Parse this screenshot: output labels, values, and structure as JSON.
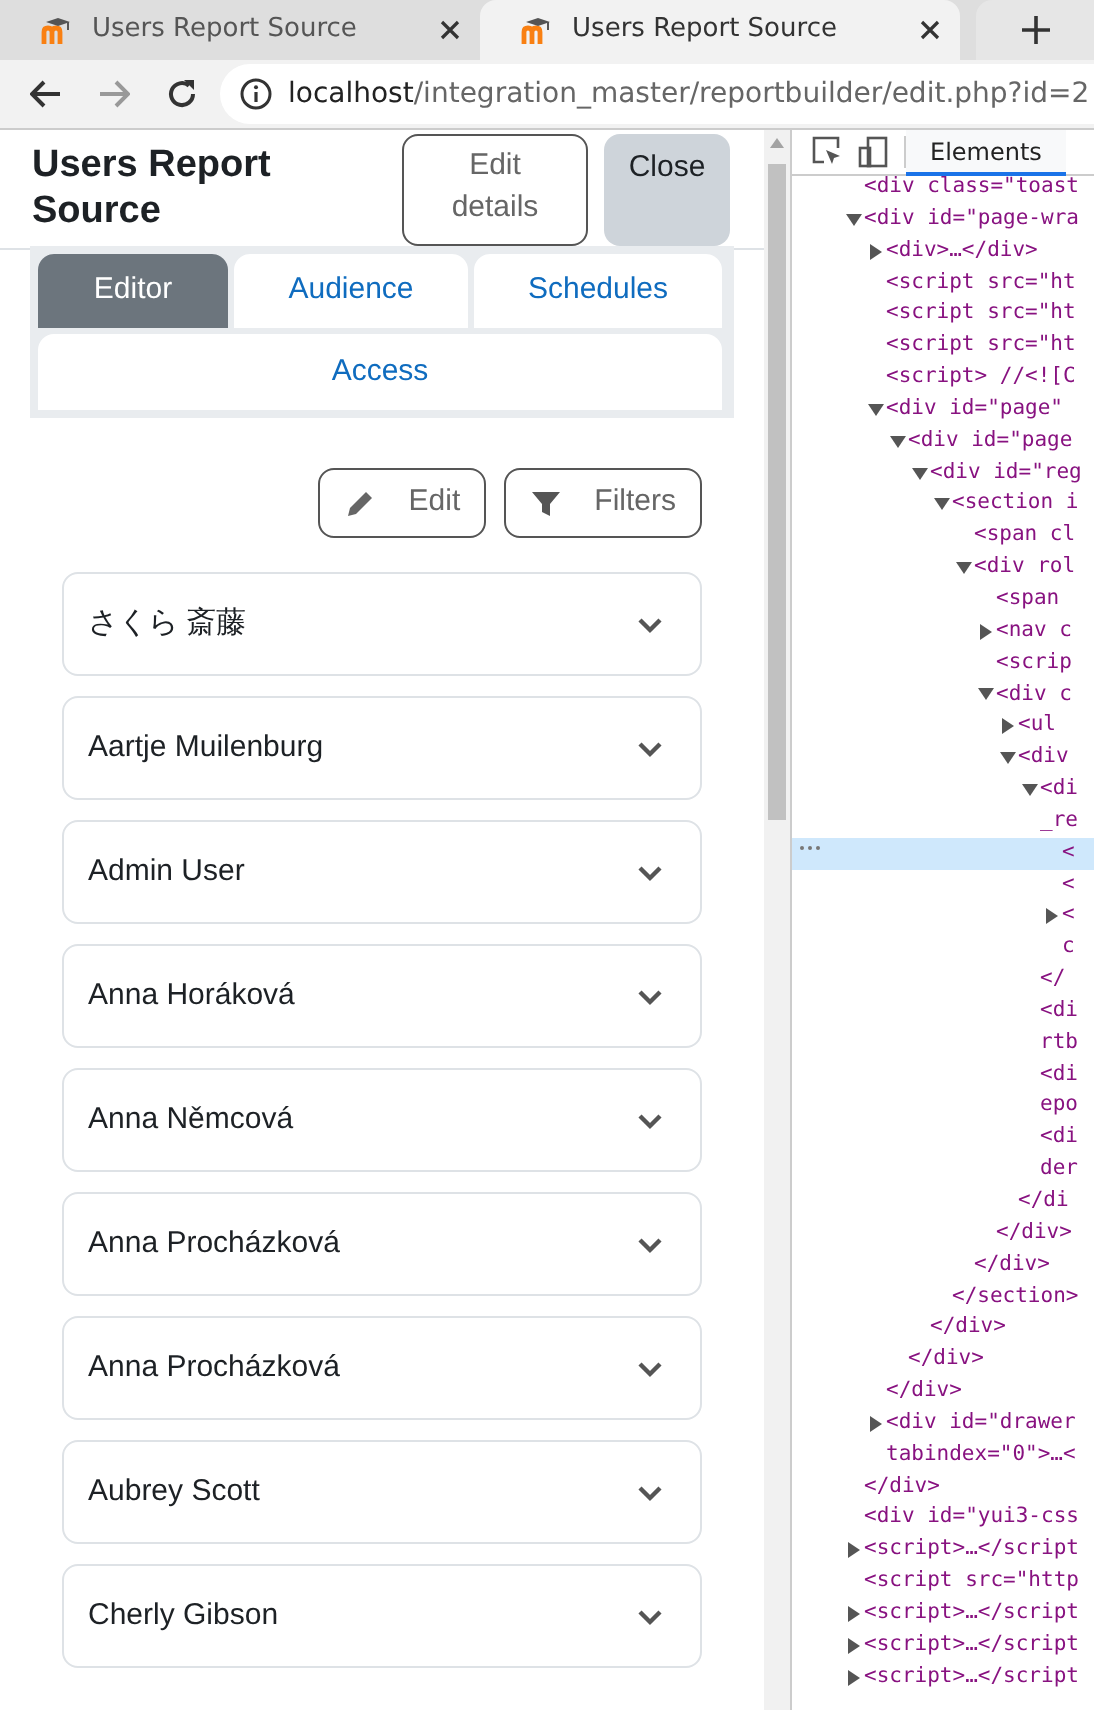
{
  "browser": {
    "tabs": [
      {
        "title": "Users Report Source",
        "selected": false
      },
      {
        "title": "Users Report Source",
        "selected": true
      }
    ],
    "forward_disabled": true,
    "address": {
      "host": "localhost",
      "path": "/integration_master/reportbuilder/edit.php?id=2"
    }
  },
  "page": {
    "title": "Users Report Source",
    "header_buttons": [
      {
        "label": "Edit details",
        "kind": "outline"
      },
      {
        "label": "Close",
        "kind": "secondary"
      }
    ],
    "tabs": [
      {
        "label": "Editor",
        "selected": true
      },
      {
        "label": "Audience",
        "selected": false
      },
      {
        "label": "Schedules",
        "selected": false
      },
      {
        "label": "Access",
        "selected": false
      }
    ],
    "toolbar_buttons": [
      {
        "label": "Edit",
        "kind": "edit"
      },
      {
        "label": "Filters",
        "kind": "filter"
      }
    ],
    "rows": [
      {
        "name": "さくら 斎藤",
        "expanded": false
      },
      {
        "name": "Aartje Muilenburg",
        "expanded": false
      },
      {
        "name": "Admin User",
        "expanded": false
      },
      {
        "name": "Anna Horáková",
        "expanded": false
      },
      {
        "name": "Anna Němcová",
        "expanded": false
      },
      {
        "name": "Anna Procházková",
        "expanded": false
      },
      {
        "name": "Anna Procházková",
        "expanded": false
      },
      {
        "name": "Aubrey Scott",
        "expanded": false
      },
      {
        "name": "Cherly Gibson",
        "expanded": false
      }
    ]
  },
  "devtools": {
    "tabs": [
      {
        "label": "Elements",
        "selected": true
      }
    ],
    "tree": [
      {
        "text": "<div class=\"toast",
        "selected": false
      },
      {
        "text": "<div id=\"page-wra",
        "expanded": true,
        "selected": false,
        "closing": "</div>",
        "children": [
          {
            "text": "<div>…</div>",
            "expanded": false,
            "selected": false
          },
          {
            "text": "<script src=\"ht",
            "selected": false
          },
          {
            "text": "<script src=\"ht",
            "selected": false
          },
          {
            "text": "<script src=\"ht",
            "selected": false
          },
          {
            "text": "<script> //<![C",
            "selected": false
          },
          {
            "text": "<div id=\"page\"",
            "expanded": true,
            "selected": false,
            "closing": "</div>",
            "children": [
              {
                "text": "<div id=\"page",
                "expanded": true,
                "selected": false,
                "closing": "</div>",
                "children": [
                  {
                    "text": "<div id=\"reg",
                    "expanded": true,
                    "selected": false,
                    "closing": "</div>",
                    "children": [
                      {
                        "text": "<section i",
                        "expanded": true,
                        "selected": false,
                        "closing": "</section>",
                        "children": [
                          {
                            "text": "<span cl",
                            "selected": false
                          },
                          {
                            "text": "<div rol",
                            "expanded": true,
                            "selected": false,
                            "closing": "</div>",
                            "children": [
                              {
                                "text": "<span",
                                "selected": false
                              },
                              {
                                "text": "<nav c",
                                "expanded": false,
                                "selected": false
                              },
                              {
                                "text": "<scrip",
                                "selected": false
                              },
                              {
                                "text": "<div c",
                                "expanded": true,
                                "selected": false,
                                "closing": "</div>",
                                "children": [
                                  {
                                    "text": "<ul",
                                    "expanded": false,
                                    "selected": false
                                  },
                                  {
                                    "text": "<div",
                                    "expanded": true,
                                    "selected": false,
                                    "closing": "</di",
                                    "children": [
                                      {
                                        "text": "<di",
                                        "continuation": "_re",
                                        "expanded": true,
                                        "selected": false,
                                        "closing": "</",
                                        "children": [
                                          {
                                            "text": "<",
                                            "selected": true
                                          },
                                          {
                                            "text": "<",
                                            "selected": false
                                          },
                                          {
                                            "text": "<",
                                            "continuation": "c",
                                            "expanded": false,
                                            "selected": false
                                          }
                                        ]
                                      },
                                      {
                                        "text": "<di",
                                        "continuation": "rtb",
                                        "selected": false
                                      },
                                      {
                                        "text": "<di",
                                        "continuation": "epo",
                                        "selected": false
                                      },
                                      {
                                        "text": "<di",
                                        "continuation": "der",
                                        "selected": false
                                      }
                                    ]
                                  }
                                ]
                              }
                            ]
                          }
                        ]
                      }
                    ]
                  }
                ]
              }
            ]
          },
          {
            "text": "<div id=\"drawer",
            "continuation": "tabindex=\"0\">…<",
            "expanded": false,
            "selected": false
          }
        ]
      },
      {
        "text": "<div id=\"yui3-css",
        "selected": false
      },
      {
        "text": "<script>…</script",
        "expanded": false,
        "selected": false
      },
      {
        "text": "<script src=\"http",
        "selected": false
      },
      {
        "text": "<script>…</script",
        "expanded": false,
        "selected": false
      },
      {
        "text": "<script>…</script",
        "expanded": false,
        "selected": false
      },
      {
        "text": "<script>…</script",
        "expanded": false,
        "selected": false
      }
    ]
  }
}
